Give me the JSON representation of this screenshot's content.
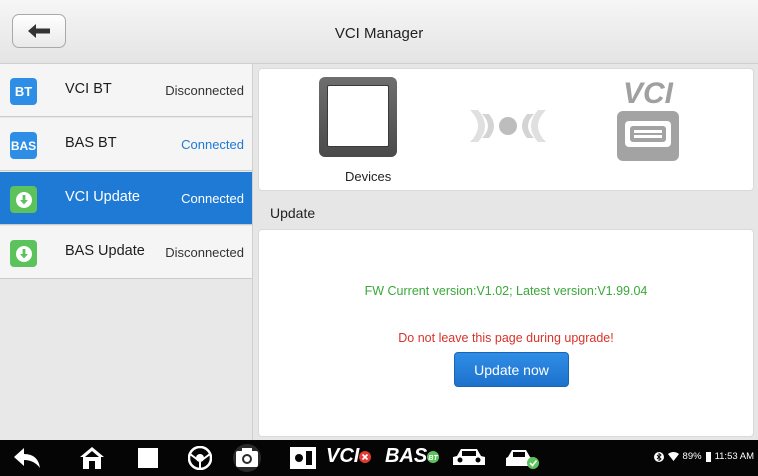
{
  "header": {
    "title": "VCI Manager"
  },
  "sidebar": {
    "items": [
      {
        "icon_label": "BT",
        "name": "VCI BT",
        "status": "Disconnected",
        "icon": "bt-icon",
        "active": false
      },
      {
        "icon_label": "BAS",
        "name": "BAS BT",
        "status": "Connected",
        "icon": "bas-icon",
        "active": false
      },
      {
        "icon_label": "",
        "name": "VCI Update",
        "status": "Connected",
        "icon": "download-icon",
        "active": true
      },
      {
        "icon_label": "",
        "name": "BAS Update",
        "status": "Disconnected",
        "icon": "download-icon",
        "active": false
      }
    ]
  },
  "devices": {
    "label": "Devices",
    "vci_logo_text": "VCI"
  },
  "update": {
    "section_label": "Update",
    "fw_version_text": "FW Current version:V1.02; Latest version:V1.99.04",
    "warning_text": "Do not leave this page during upgrade!",
    "button_label": "Update now"
  },
  "taskbar": {
    "vci_label": "VCI",
    "bas_label": "BAS",
    "battery": "89%",
    "time": "11:53 AM"
  },
  "colors": {
    "accent": "#1f7ad6",
    "connected": "#1f7ad6",
    "fw_text": "#3aa83a",
    "warning": "#d8332b"
  }
}
